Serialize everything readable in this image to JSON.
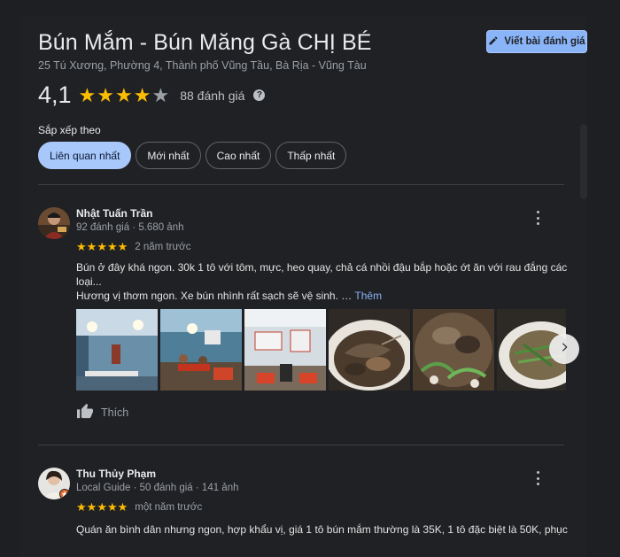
{
  "place": {
    "title": "Bún Mắm - Bún Măng Gà CHỊ BÉ",
    "address": "25 Tú Xương, Phường 4, Thành phố Vũng Tầu, Bà Rịa - Vũng Tàu",
    "rating": "4,1",
    "rating_value": 4.1,
    "review_count": "88 đánh giá",
    "help_icon": "?"
  },
  "write_review": {
    "label": "Viết bài đánh giá",
    "icon": "pencil-icon"
  },
  "sort": {
    "label": "Sắp xếp theo",
    "chips": [
      "Liên quan nhất",
      "Mới nhất",
      "Cao nhất",
      "Thấp nhất"
    ],
    "active": "Liên quan nhất"
  },
  "reviews": [
    {
      "name": "Nhật Tuấn Trần",
      "meta": "92 đánh giá · 5.680 ảnh",
      "stars": 5,
      "when": "2 năm trước",
      "text_line1": "Bún ở đây khá ngon. 30k 1 tô với tôm, mực, heo quay, chả cá nhồi đậu bắp hoặc ớt ăn với rau đắng các",
      "text_line2": "loại...",
      "text_line3": "Hương vị thơm ngon.  Xe bún nhình rất sạch sẽ vệ sinh. …",
      "more_label": "Thêm",
      "like_label": "Thích"
    },
    {
      "name": "Thu Thủy Phạm",
      "meta": "Local Guide · 50 đánh giá · 141 ảnh",
      "stars": 5,
      "when": "một năm trước",
      "text_line1": "Quán ăn bình dân nhưng ngon, hợp khẩu vị, giá 1 tô bún mắm thường là 35K, 1 tô đặc biệt là 50K, phục"
    }
  ],
  "colors": {
    "star": "#fbbc04",
    "accent": "#8ab4f8",
    "background": "#202124"
  }
}
